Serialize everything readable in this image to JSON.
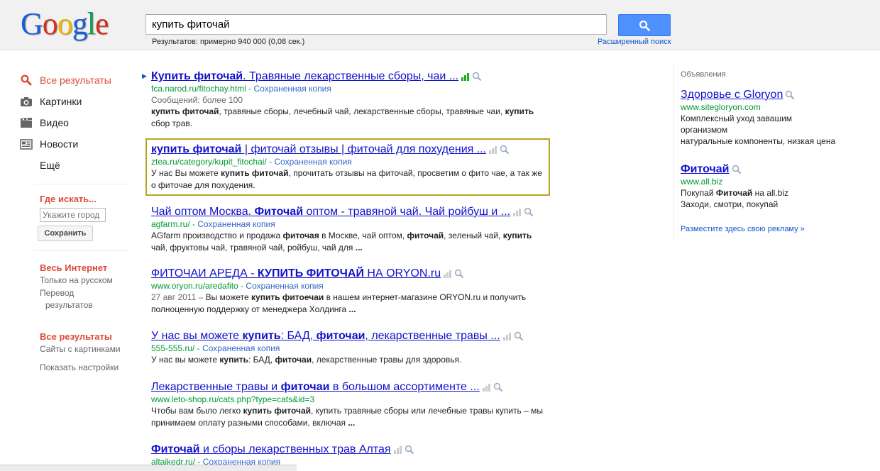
{
  "header": {
    "logo": "Google",
    "query": "купить фиточай",
    "stats": "Результатов: примерно 940 000 (0,08 сек.)",
    "advanced_search": "Расширенный поиск"
  },
  "leftnav": {
    "items": [
      {
        "label": "Все результаты",
        "icon": "search-icon"
      },
      {
        "label": "Картинки",
        "icon": "camera-icon"
      },
      {
        "label": "Видео",
        "icon": "film-icon"
      },
      {
        "label": "Новости",
        "icon": "newspaper-icon"
      },
      {
        "label": "Ещё",
        "icon": ""
      }
    ],
    "where_title": "Где искать...",
    "city_placeholder": "Укажите город",
    "save_label": "Сохранить",
    "web_group": {
      "header": "Весь Интернет",
      "items": [
        "Только на русском",
        "Перевод",
        "результатов"
      ]
    },
    "results_group": {
      "header": "Все результаты",
      "items": [
        "Сайты с картинками"
      ]
    },
    "show_settings": "Показать настройки"
  },
  "results": [
    {
      "title_html": [
        {
          "t": "Купить фиточай",
          "b": true
        },
        {
          "t": ". Травяные лекарственные сборы, чаи ...",
          "b": false
        }
      ],
      "url": "fca.narod.ru/fitochay.html",
      "cache": "Сохраненная копия",
      "meta": "Сообщений: более 100",
      "snippet": [
        {
          "t": "купить фиточай",
          "b": true
        },
        {
          "t": ", травяные сборы, лечебный чай, лекарственные сборы, травяные чаи, ",
          "b": false
        },
        {
          "t": "купить",
          "b": true
        },
        {
          "t": " сбор трав.",
          "b": false
        }
      ],
      "bars": "green"
    },
    {
      "title_html": [
        {
          "t": "купить фиточай",
          "b": true
        },
        {
          "t": " | фиточай отзывы | фиточай для похудения ...",
          "b": false
        }
      ],
      "url": "ztea.ru/category/kupit_fitochai/",
      "cache": "Сохраненная копия",
      "meta": "",
      "snippet": [
        {
          "t": "У нас Вы можете ",
          "b": false
        },
        {
          "t": "купить фиточай",
          "b": true
        },
        {
          "t": ", прочитать отзывы на фиточай, просветим о фито чае, а так же о фиточае для похудения.",
          "b": false
        }
      ],
      "bars": "grey"
    },
    {
      "title_html": [
        {
          "t": "Чай оптом Москва. ",
          "b": false
        },
        {
          "t": "Фиточай",
          "b": true
        },
        {
          "t": " оптом - травяной чай. Чай ройбуш и ...",
          "b": false
        }
      ],
      "url": "agfarm.ru/",
      "cache": "Сохраненная копия",
      "meta": "",
      "snippet": [
        {
          "t": "AGfarm производство и продажа ",
          "b": false
        },
        {
          "t": "фиточая",
          "b": true
        },
        {
          "t": " в Москве, чай оптом, ",
          "b": false
        },
        {
          "t": "фиточай",
          "b": true
        },
        {
          "t": ", зеленый чай, ",
          "b": false
        },
        {
          "t": "купить",
          "b": true
        },
        {
          "t": " чай, фруктовы чай, травяной чай, ройбуш, чай для ",
          "b": false
        },
        {
          "t": "...",
          "b": true
        }
      ],
      "bars": "grey"
    },
    {
      "title_html": [
        {
          "t": "ФИТОЧАИ АРЕДА - ",
          "b": false
        },
        {
          "t": "КУПИТЬ ФИТОЧАЙ",
          "b": true
        },
        {
          "t": " НА ORYON.ru",
          "b": false
        }
      ],
      "url": "www.oryon.ru/aredafito",
      "cache": "Сохраненная копия",
      "meta": "",
      "snippet": [
        {
          "t": "27 авг 2011 – ",
          "b": false,
          "grey": true
        },
        {
          "t": "Вы можете ",
          "b": false
        },
        {
          "t": "купить фитоечаи",
          "b": true
        },
        {
          "t": " в нашем интернет-магазине ORYON.ru и получить полноценную поддержку от менеджера Холдинга ",
          "b": false
        },
        {
          "t": "...",
          "b": true
        }
      ],
      "bars": "grey"
    },
    {
      "title_html": [
        {
          "t": "У нас вы можете ",
          "b": false
        },
        {
          "t": "купить",
          "b": true
        },
        {
          "t": ": БАД, ",
          "b": false
        },
        {
          "t": "фиточаи",
          "b": true
        },
        {
          "t": ", лекарственные травы ...",
          "b": false
        }
      ],
      "url": "555-555.ru/",
      "cache": "Сохраненная копия",
      "meta": "",
      "snippet": [
        {
          "t": "У нас вы можете ",
          "b": false
        },
        {
          "t": "купить",
          "b": true
        },
        {
          "t": ": БАД, ",
          "b": false
        },
        {
          "t": "фиточаи",
          "b": true
        },
        {
          "t": ", лекарственные травы для здоровья.",
          "b": false
        }
      ],
      "bars": "grey"
    },
    {
      "title_html": [
        {
          "t": "Лекарственные травы и ",
          "b": false
        },
        {
          "t": "фиточаи",
          "b": true
        },
        {
          "t": " в большом ассортименте ...",
          "b": false
        }
      ],
      "url": "www.leto-shop.ru/cats.php?type=cats&id=3",
      "cache": "",
      "meta": "",
      "snippet": [
        {
          "t": "Чтобы вам было легко ",
          "b": false
        },
        {
          "t": "купить фиточай",
          "b": true
        },
        {
          "t": ", купить травяные сборы или лечебные травы купить – мы принимаем оплату разными способами, включая ",
          "b": false
        },
        {
          "t": "...",
          "b": true
        }
      ],
      "bars": "grey"
    },
    {
      "title_html": [
        {
          "t": "Фиточай",
          "b": true
        },
        {
          "t": " и сборы лекарственных трав Алтая",
          "b": false
        }
      ],
      "url": "altaikedr.ru/",
      "cache": "Сохраненная копия",
      "meta": "",
      "snippet": [],
      "bars": "grey"
    }
  ],
  "ads": {
    "label": "Объявления",
    "items": [
      {
        "title": [
          {
            "t": "Здоровье с Gloryon",
            "b": false
          }
        ],
        "url": "www.sitegloryon.com",
        "lines": [
          [
            {
              "t": "Комплексный уход завашим",
              "b": false
            }
          ],
          [
            {
              "t": "организмом",
              "b": false
            }
          ],
          [
            {
              "t": "натуральные компоненты, низкая цена",
              "b": false
            }
          ]
        ]
      },
      {
        "title": [
          {
            "t": "Фиточай",
            "b": true
          }
        ],
        "url": "www.all.biz",
        "lines": [
          [
            {
              "t": "Покупай ",
              "b": false
            },
            {
              "t": "Фиточай",
              "b": true
            },
            {
              "t": " на all.biz",
              "b": false
            }
          ],
          [
            {
              "t": "Заходи, смотри, покупай",
              "b": false
            }
          ]
        ]
      }
    ],
    "place_ad": "Разместите здесь свою рекламу »"
  },
  "colors": {
    "link": "#1111cc",
    "url": "#009933",
    "accent": "#dd4b39",
    "button": "#4d90fe",
    "highlight": "#b4a623"
  }
}
